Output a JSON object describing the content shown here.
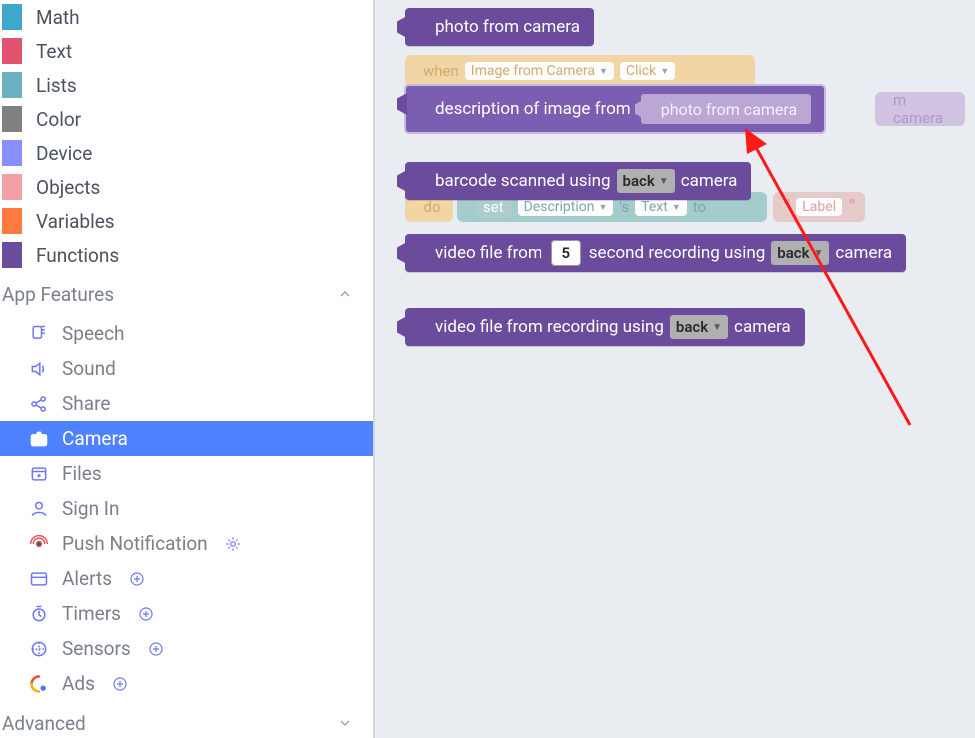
{
  "categories": [
    {
      "label": "Math",
      "color": "#3fa7cc"
    },
    {
      "label": "Text",
      "color": "#e0526f"
    },
    {
      "label": "Lists",
      "color": "#6bb0c0"
    },
    {
      "label": "Color",
      "color": "#808080"
    },
    {
      "label": "Device",
      "color": "#8a8fff"
    },
    {
      "label": "Objects",
      "color": "#f29fa6"
    },
    {
      "label": "Variables",
      "color": "#ff7a3f"
    },
    {
      "label": "Functions",
      "color": "#6b4c9c"
    }
  ],
  "sections": {
    "app_features": {
      "title": "App Features"
    },
    "advanced": {
      "title": "Advanced"
    }
  },
  "features": [
    {
      "key": "speech",
      "label": "Speech",
      "icon": "speech"
    },
    {
      "key": "sound",
      "label": "Sound",
      "icon": "sound"
    },
    {
      "key": "share",
      "label": "Share",
      "icon": "share"
    },
    {
      "key": "camera",
      "label": "Camera",
      "icon": "camera",
      "selected": true
    },
    {
      "key": "files",
      "label": "Files",
      "icon": "files"
    },
    {
      "key": "signin",
      "label": "Sign In",
      "icon": "signin"
    },
    {
      "key": "push",
      "label": "Push Notification",
      "icon": "push",
      "extra": "gear"
    },
    {
      "key": "alerts",
      "label": "Alerts",
      "icon": "alerts",
      "extra": "plus"
    },
    {
      "key": "timers",
      "label": "Timers",
      "icon": "timers",
      "extra": "plus"
    },
    {
      "key": "sensors",
      "label": "Sensors",
      "icon": "sensors",
      "extra": "plus"
    },
    {
      "key": "ads",
      "label": "Ads",
      "icon": "ads",
      "extra": "plus"
    }
  ],
  "blocks": {
    "photo": {
      "label": "photo from camera"
    },
    "desc": {
      "prefix": "description of image from",
      "input": "photo from camera"
    },
    "barcode": {
      "prefix": "barcode scanned using",
      "dropdown": "back",
      "suffix": "camera"
    },
    "video_timed": {
      "prefix": "video file from",
      "seconds": "5",
      "mid": "second recording using",
      "dropdown": "back",
      "suffix": "camera"
    },
    "video": {
      "prefix": "video file from recording using",
      "dropdown": "back",
      "suffix": "camera"
    }
  },
  "ghost": {
    "when": {
      "word": "when",
      "comp": "Image from Camera",
      "evt": "Click"
    },
    "trail": {
      "text": "m camera"
    },
    "do": {
      "word": "do",
      "set": "set",
      "comp": "Description",
      "prop": "Text",
      "to": "to",
      "label": "Label"
    }
  }
}
